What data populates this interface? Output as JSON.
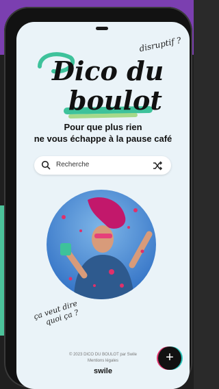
{
  "logo": {
    "line1": "Dico du",
    "line2": "boulot"
  },
  "tagline": "disruptif ?",
  "subtitle": {
    "line1": "Pour que plus rien",
    "line2": "ne vous échappe à la pause café"
  },
  "search": {
    "placeholder": "Recherche"
  },
  "handwritten": {
    "line1": "ça veut dire",
    "line2": "quoi ça ?"
  },
  "footer": {
    "copyright": "© 2023 DICO DU BOULOT par Swile",
    "legal": "Mentions légales",
    "brand": "swile"
  },
  "fab": {
    "label": "+"
  },
  "colors": {
    "accent_green": "#3ec29b",
    "accent_purple": "#7b3fb0",
    "background": "#eaf3f8"
  }
}
